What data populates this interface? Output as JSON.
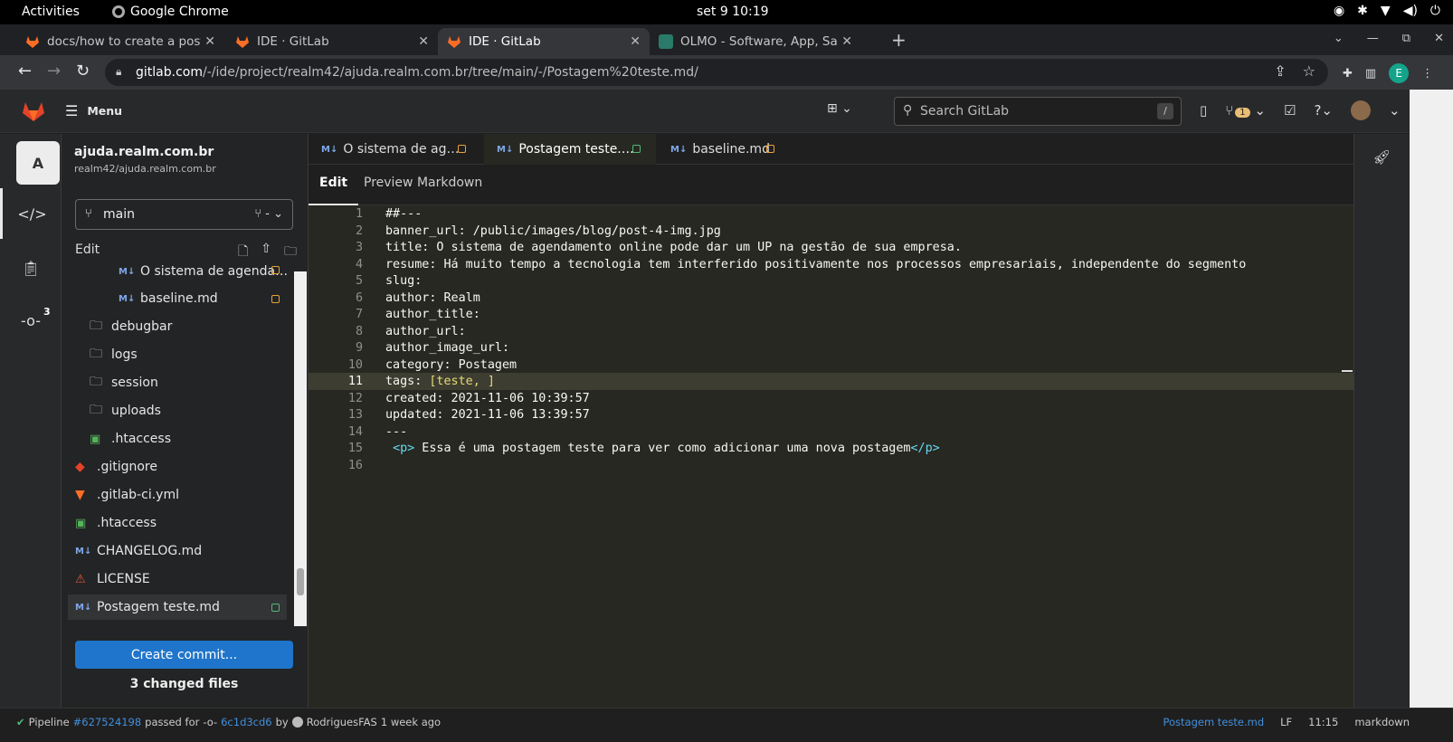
{
  "os": {
    "activities": "Activities",
    "app_name": "Google Chrome",
    "clock": "set 9  10:19"
  },
  "browser": {
    "tabs": [
      {
        "title": "docs/how to create a post",
        "active": false
      },
      {
        "title": "IDE · GitLab",
        "active": false
      },
      {
        "title": "IDE · GitLab",
        "active": true
      },
      {
        "title": "OLMO - Software, App, Sa",
        "active": false
      }
    ],
    "url_host": "gitlab.com",
    "url_path": "/-/ide/project/realm42/ajuda.realm.com.br/tree/main/-/Postagem%20teste.md/",
    "profile_initial": "E"
  },
  "gitlab": {
    "menu_label": "Menu",
    "search_placeholder": "Search GitLab",
    "search_shortcut": "/",
    "mr_count": "1"
  },
  "project": {
    "avatar_letter": "A",
    "name": "ajuda.realm.com.br",
    "path": "realm42/ajuda.realm.com.br",
    "branch": "main",
    "branch_extra": "-",
    "edit_label": "Edit",
    "changes_count": "3",
    "tree": [
      {
        "name": "O sistema de agenda…",
        "type": "md",
        "indent": 2,
        "status": "modified"
      },
      {
        "name": "baseline.md",
        "type": "md",
        "indent": 2,
        "status": "modified"
      },
      {
        "name": "debugbar",
        "type": "folder",
        "indent": 1,
        "status": ""
      },
      {
        "name": "logs",
        "type": "folder",
        "indent": 1,
        "status": ""
      },
      {
        "name": "session",
        "type": "folder",
        "indent": 1,
        "status": ""
      },
      {
        "name": "uploads",
        "type": "folder",
        "indent": 1,
        "status": ""
      },
      {
        "name": ".htaccess",
        "type": "htaccess",
        "indent": 1,
        "status": ""
      },
      {
        "name": ".gitignore",
        "type": "git",
        "indent": 0,
        "status": ""
      },
      {
        "name": ".gitlab-ci.yml",
        "type": "gitlab",
        "indent": 0,
        "status": ""
      },
      {
        "name": ".htaccess",
        "type": "htaccess",
        "indent": 0,
        "status": ""
      },
      {
        "name": "CHANGELOG.md",
        "type": "md",
        "indent": 0,
        "status": ""
      },
      {
        "name": "LICENSE",
        "type": "license",
        "indent": 0,
        "status": ""
      },
      {
        "name": "Postagem teste.md",
        "type": "md",
        "indent": 0,
        "status": "added",
        "selected": true
      }
    ],
    "commit_button": "Create commit...",
    "changed_files": "3 changed files"
  },
  "editor": {
    "file_tabs": [
      {
        "name": "O sistema de ag…",
        "status": "modified",
        "active": false
      },
      {
        "name": "Postagem teste.…",
        "status": "added",
        "active": true
      },
      {
        "name": "baseline.md",
        "status": "modified",
        "active": false
      }
    ],
    "mode_edit": "Edit",
    "mode_preview": "Preview Markdown",
    "lines": [
      "##---",
      "banner_url: /public/images/blog/post-4-img.jpg",
      "title: O sistema de agendamento online pode dar um UP na gestão de sua empresa.",
      "resume: Há muito tempo a tecnologia tem interferido positivamente nos processos empresariais, independente do segmento",
      "slug:",
      "author: Realm",
      "author_title:",
      "author_url:",
      "author_image_url:",
      "category: Postagem",
      "tags: [teste, ]",
      "created: 2021-11-06 10:39:57",
      "updated: 2021-11-06 13:39:57",
      "---",
      " <p> Essa é uma postagem teste para ver como adicionar uma nova postagem</p>",
      ""
    ],
    "current_line": 11
  },
  "statusbar": {
    "pipeline_label": "Pipeline",
    "pipeline_id": "#627524198",
    "passed_for": "passed for",
    "commit_sha": "6c1d3cd6",
    "by": "by",
    "author": "RodriguesFAS",
    "when": "1 week ago",
    "file": "Postagem teste.md",
    "eol": "LF",
    "position": "11:15",
    "language": "markdown"
  },
  "colors": {
    "primary_button": "#1f75cb",
    "editor_bg": "#272822",
    "modified": "#e9a33a",
    "added": "#52b87a"
  }
}
